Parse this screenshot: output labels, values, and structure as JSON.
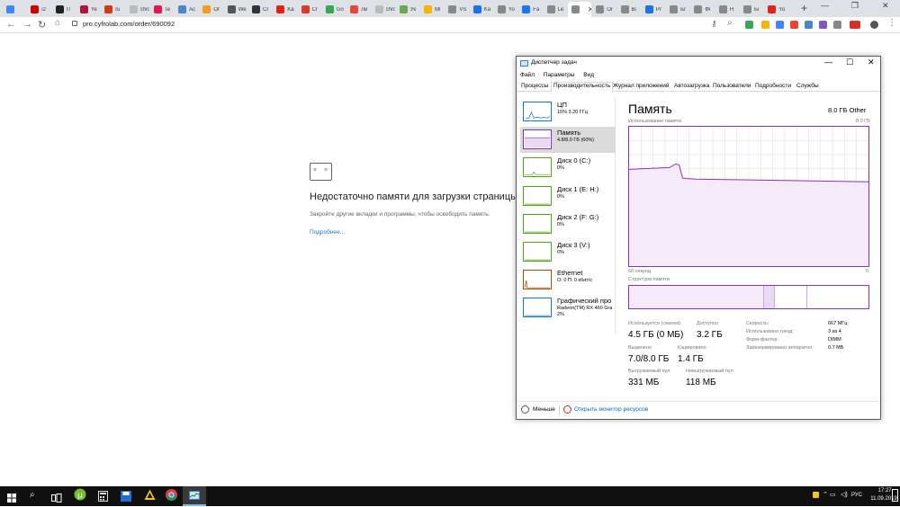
{
  "browser": {
    "tabs": [
      {
        "label": "",
        "color": "#4285f4"
      },
      {
        "label": "i2",
        "color": "#cc0000"
      },
      {
        "label": "IT",
        "color": "#222222"
      },
      {
        "label": "Ye",
        "color": "#b0163c"
      },
      {
        "label": "ru",
        "color": "#d13b12"
      },
      {
        "label": "chron",
        "color": "#bbbbbb"
      },
      {
        "label": "Te",
        "color": "#e01a4f"
      },
      {
        "label": "Ac",
        "color": "#4a86c8"
      },
      {
        "label": "Or",
        "color": "#f0a01e"
      },
      {
        "label": "We",
        "color": "#555555"
      },
      {
        "label": "Cr",
        "color": "#333333"
      },
      {
        "label": "Ka",
        "color": "#e62117"
      },
      {
        "label": "Cr",
        "color": "#d93a2c"
      },
      {
        "label": "Go",
        "color": "#34a853"
      },
      {
        "label": "Ли",
        "color": "#e8453c"
      },
      {
        "label": "chron",
        "color": "#bbbbbb"
      },
      {
        "label": "Ук",
        "color": "#6aa84f"
      },
      {
        "label": "Ml",
        "color": "#f4b400"
      },
      {
        "label": "VS",
        "color": "#888888"
      },
      {
        "label": "Ka",
        "color": "#1a73e8"
      },
      {
        "label": "Yo",
        "color": "#888888"
      },
      {
        "label": "Fa",
        "color": "#1877f2"
      },
      {
        "label": "Le",
        "color": "#888888"
      },
      {
        "label": "",
        "color": "#888888"
      },
      {
        "label": "Or",
        "color": "#888888"
      },
      {
        "label": "Bi",
        "color": "#888888"
      },
      {
        "label": "Pr",
        "color": "#1a73e8"
      },
      {
        "label": "Бг",
        "color": "#888888"
      },
      {
        "label": "Фі",
        "color": "#888888"
      },
      {
        "label": "Н",
        "color": "#888888"
      },
      {
        "label": "Бі",
        "color": "#888888"
      },
      {
        "label": "Yo",
        "color": "#e62117"
      }
    ],
    "url": "pro.cyfrolab.com/order/690092",
    "new_tab": "+",
    "close_tab": "✕"
  },
  "error_page": {
    "title": "Недостаточно памяти для загрузки страницы",
    "text": "Закройте другие вкладки и программы, чтобы освободить память.",
    "link": "Подробнее..."
  },
  "taskmgr": {
    "title": "Диспетчер задач",
    "menu": [
      "Файл",
      "Параметры",
      "Вид"
    ],
    "tabs": [
      "Процессы",
      "Производительность",
      "Журнал приложений",
      "Автозагрузка",
      "Пользователи",
      "Подробности",
      "Службы"
    ],
    "active_tab": 1,
    "resources": [
      {
        "name": "ЦП",
        "sub": "15% 3.20 ГГц",
        "color": "#117dbb"
      },
      {
        "name": "Память",
        "sub": "4.8/8.0 ГБ (60%)",
        "color": "#8b2fbf"
      },
      {
        "name": "Диск 0 (C:)",
        "sub": "0%",
        "color": "#4da60c"
      },
      {
        "name": "Диск 1 (E: H:)",
        "sub": "0%",
        "color": "#4da60c"
      },
      {
        "name": "Диск 2 (F: G:)",
        "sub": "0%",
        "color": "#4da60c"
      },
      {
        "name": "Диск 3 (V:)",
        "sub": "0%",
        "color": "#4da60c"
      },
      {
        "name": "Ethernet",
        "sub": "О: 0 П: 0 кбит/с",
        "color": "#a74f01"
      },
      {
        "name": "Графический про",
        "sub": "Radeon(TM) RX 460 Gra",
        "sub2": "2%",
        "color": "#117dbb"
      }
    ],
    "detail": {
      "title": "Память",
      "total": "8.0 ГБ Other",
      "usage_label": "Использование памяти",
      "usage_max": "8.0 ГБ",
      "time_label": "60 секунд",
      "time_zero": "0",
      "struct_label": "Структура памяти",
      "stats": {
        "in_use_label": "Используется (сжатая)",
        "in_use": "4.5 ГБ (0 МБ)",
        "available_label": "Доступно",
        "available": "3.2 ГБ",
        "committed_label": "Выделено",
        "committed": "7.0/8.0 ГБ",
        "cached_label": "Кэшировано",
        "cached": "1.4 ГБ",
        "paged_label": "Выгружаемый пул",
        "paged": "331 МБ",
        "nonpaged_label": "Невыгружаемый пул",
        "nonpaged": "118 МБ"
      },
      "kv": [
        {
          "k": "Скорость:",
          "v": "667 МГц"
        },
        {
          "k": "Использовано гнезд:",
          "v": "3 из 4"
        },
        {
          "k": "Форм-фактор:",
          "v": "DIMM"
        },
        {
          "k": "Зарезервировано аппаратно:",
          "v": "0.7 МБ"
        }
      ]
    },
    "footer": {
      "fewer": "Меньше",
      "resmon": "Открыть монитор ресурсов"
    }
  },
  "taskbar": {
    "lang": "РУС",
    "time": "17:27",
    "date": "11.09.2019"
  }
}
